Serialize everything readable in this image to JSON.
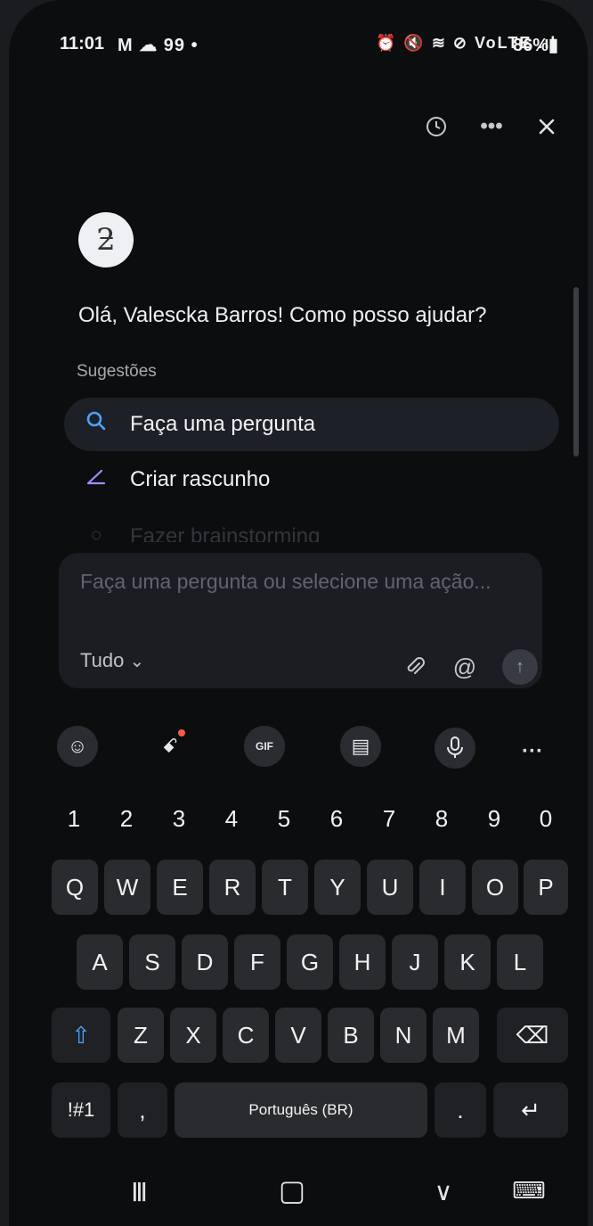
{
  "status_bar": {
    "time": "11:01",
    "left_icons": "M ☁ 99 •",
    "right_icons": "⏰ 🔇 ≋ ⊘ VoLTE .ıl",
    "battery": "86%▮"
  },
  "header": {
    "history_icon": "history-icon",
    "more_icon": "more-options-icon",
    "close_icon": "close-icon"
  },
  "assistant": {
    "avatar": "ƻ",
    "greeting": "Olá, Valescka Barros! Como posso ajudar?",
    "suggestions_label": "Sugestões",
    "suggestions": [
      {
        "icon": "search-icon",
        "glyph": "⚲",
        "label": "Faça uma pergunta"
      },
      {
        "icon": "pencil-icon",
        "glyph": "∠",
        "label": "Criar rascunho"
      },
      {
        "icon": "bulb-icon",
        "glyph": "○",
        "label": "Fazer brainstorming"
      }
    ]
  },
  "composer": {
    "placeholder": "Faça uma pergunta ou selecione uma ação...",
    "scope_label": "Tudo",
    "scope_chevron": "⌄",
    "attach_glyph": "📎",
    "mention_glyph": "@",
    "send_glyph": "↑"
  },
  "keyboard_toolbar": {
    "emoji_glyph": "☺",
    "bixby_glyph": "ꗃ",
    "gif_label": "GIF",
    "clipboard_glyph": "▤",
    "mic_glyph": "🎙",
    "more_glyph": "···"
  },
  "keyboard": {
    "numbers": [
      "1",
      "2",
      "3",
      "4",
      "5",
      "6",
      "7",
      "8",
      "9",
      "0"
    ],
    "row1": [
      "Q",
      "W",
      "E",
      "R",
      "T",
      "Y",
      "U",
      "I",
      "O",
      "P"
    ],
    "row2": [
      "A",
      "S",
      "D",
      "F",
      "G",
      "H",
      "J",
      "K",
      "L"
    ],
    "row3": [
      "Z",
      "X",
      "C",
      "V",
      "B",
      "N",
      "M"
    ],
    "shift_glyph": "⇧",
    "backspace_glyph": "⌫",
    "symbols_label": "!#1",
    "comma": ",",
    "space_label": "Português (BR)",
    "period": ".",
    "enter_glyph": "↵"
  },
  "nav_bar": {
    "recents_glyph": "|||",
    "home_glyph": "▢",
    "back_glyph": "∨",
    "keyboard_glyph": "⌨"
  },
  "colors": {
    "accent_blue": "#4aa3ff",
    "accent_purple": "#a38bff",
    "background": "#0c0d0f"
  }
}
